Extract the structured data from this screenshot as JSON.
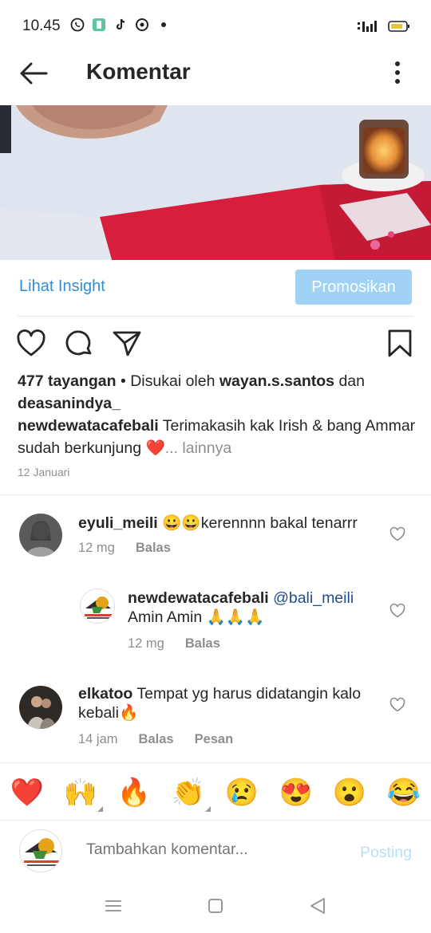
{
  "status_bar": {
    "time": "10.45",
    "icons": [
      "whatsapp-icon",
      "app-icon",
      "tiktok-icon",
      "browser-icon",
      "dot-icon"
    ],
    "right_icons": [
      "signal-icon",
      "battery-icon"
    ]
  },
  "header": {
    "title": "Komentar"
  },
  "insight": {
    "link_label": "Lihat Insight",
    "promote_label": "Promosikan"
  },
  "post": {
    "views": "477 tayangan",
    "liked_by_prefix": " • Disukai oleh ",
    "liked_user_1": "wayan.s.santos",
    "liked_and": " dan",
    "liked_user_2": "deasanindya_",
    "author": "newdewatacafebali",
    "caption": " Terimakasih kak Irish & bang Ammar sudah berkunjung ❤️",
    "more": "... lainnya",
    "date": "12 Januari"
  },
  "comments": [
    {
      "user": "eyuli_meili",
      "text": " 😀😀kerennnn bakal tenarrr",
      "time": "12 mg",
      "reply_label": "Balas"
    },
    {
      "user": "newdewatacafebali",
      "mention": " @bali_meili",
      "text": "Amin Amin 🙏🙏🙏",
      "time": "12 mg",
      "reply_label": "Balas",
      "avatar_text": "NEW DEWATA CAFE"
    },
    {
      "user": "elkatoo",
      "text": " Tempat yg harus didatangin kalo kebali🔥",
      "time": "14 jam",
      "reply_label": "Balas",
      "message_label": "Pesan"
    }
  ],
  "emoji_bar": [
    "❤️",
    "🙌",
    "🔥",
    "👏",
    "😢",
    "😍",
    "😮",
    "😂"
  ],
  "composer": {
    "placeholder": "Tambahkan komentar...",
    "post_label": "Posting",
    "avatar_text": "NEW DEWATA CAFE"
  },
  "colors": {
    "link_blue": "#2d8fd8",
    "promo_bg": "#9fd2f4",
    "muted": "#8e8e8e",
    "mention": "#1f4e8c"
  }
}
